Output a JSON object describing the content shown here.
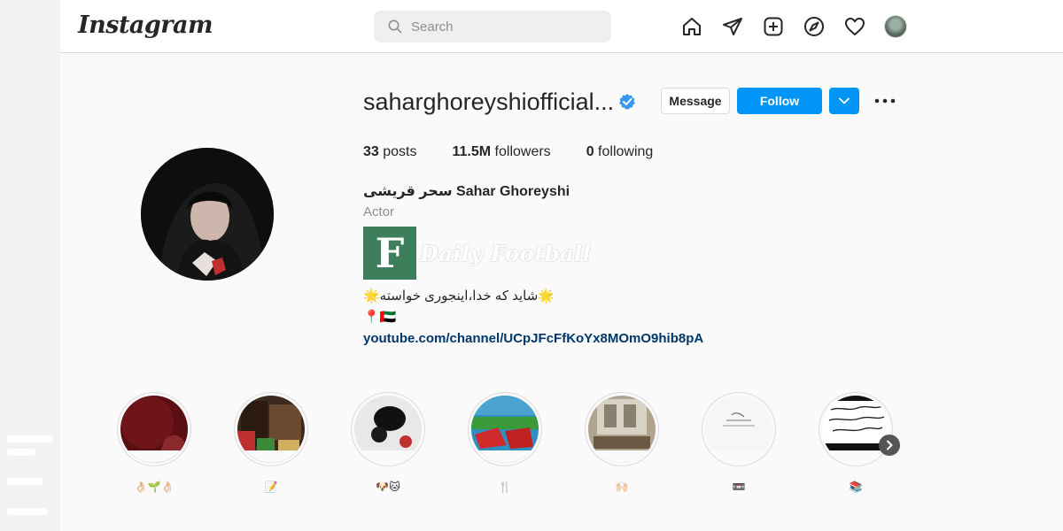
{
  "header": {
    "logo": "Instagram",
    "search": {
      "placeholder": "Search",
      "icon": "search-icon"
    },
    "nav_icons": [
      "home-icon",
      "direct-icon",
      "new-post-icon",
      "explore-icon",
      "activity-icon",
      "profile-avatar"
    ]
  },
  "profile": {
    "username": "saharghoreyshiofficial...",
    "verified": true,
    "message_label": "Message",
    "follow_label": "Follow",
    "stats": {
      "posts_count": "33",
      "posts_label": "posts",
      "followers_count": "11.5M",
      "followers_label": "followers",
      "following_count": "0",
      "following_label": "following"
    },
    "full_name": "سحر قریشی Sahar Ghoreyshi",
    "category": "Actor",
    "watermark": "Daily Football",
    "bio_line": "🌟شاید که خدا،اینجوری خواسته🌟",
    "location_line": "📍🇦🇪",
    "link": "youtube.com/channel/UCpJFcFfKoYx8MOmO9hib8pA"
  },
  "highlights": [
    {
      "label": "👌🏻🌱👌🏻"
    },
    {
      "label": "📝"
    },
    {
      "label": "🐶🐱"
    },
    {
      "label": "🍴"
    },
    {
      "label": "🙌🏻"
    },
    {
      "label": "📼"
    },
    {
      "label": "📚"
    }
  ],
  "colors": {
    "accent": "#0095f6",
    "link": "#00376b",
    "verified": "#3897f0",
    "muted": "#8e8e8e"
  }
}
